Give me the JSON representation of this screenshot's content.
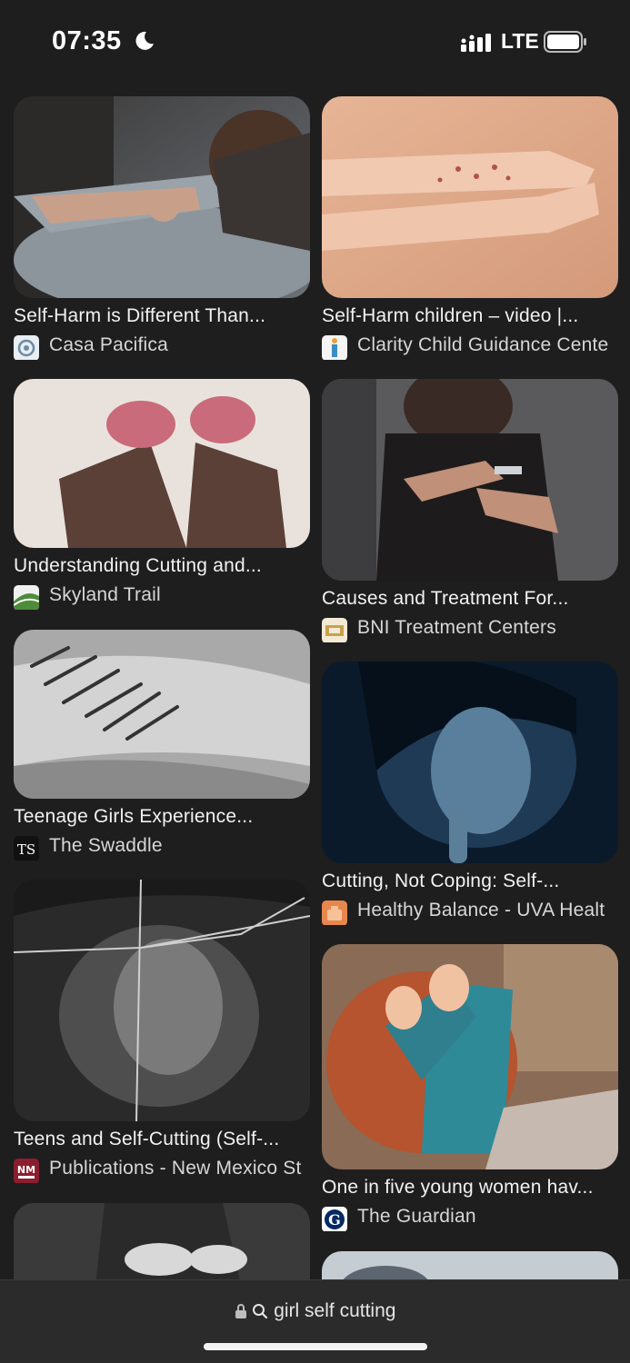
{
  "status_bar": {
    "time": "07:35",
    "network": "LTE"
  },
  "results": [
    {
      "caption": "Self-Harm is Different Than...",
      "source": "Casa Pacifica"
    },
    {
      "caption": "Self-Harm children – video |...",
      "source": "Clarity Child Guidance Cente"
    },
    {
      "caption": "Understanding Cutting and...",
      "source": "Skyland Trail"
    },
    {
      "caption": "Causes and Treatment For...",
      "source": "BNI Treatment Centers"
    },
    {
      "caption": "Teenage Girls Experience...",
      "source": "The Swaddle"
    },
    {
      "caption": "Cutting, Not Coping: Self-...",
      "source": "Healthy Balance - UVA Healt"
    },
    {
      "caption": "Teens and Self-Cutting (Self-...",
      "source": "Publications - New Mexico St"
    },
    {
      "caption": "One in five young women hav...",
      "source": "The Guardian"
    }
  ],
  "address_bar": {
    "query": "girl self cutting"
  },
  "colors": {
    "background": "#1e1e1f",
    "bottom_bar": "#2b2b2c",
    "text": "#f2f2f2"
  }
}
